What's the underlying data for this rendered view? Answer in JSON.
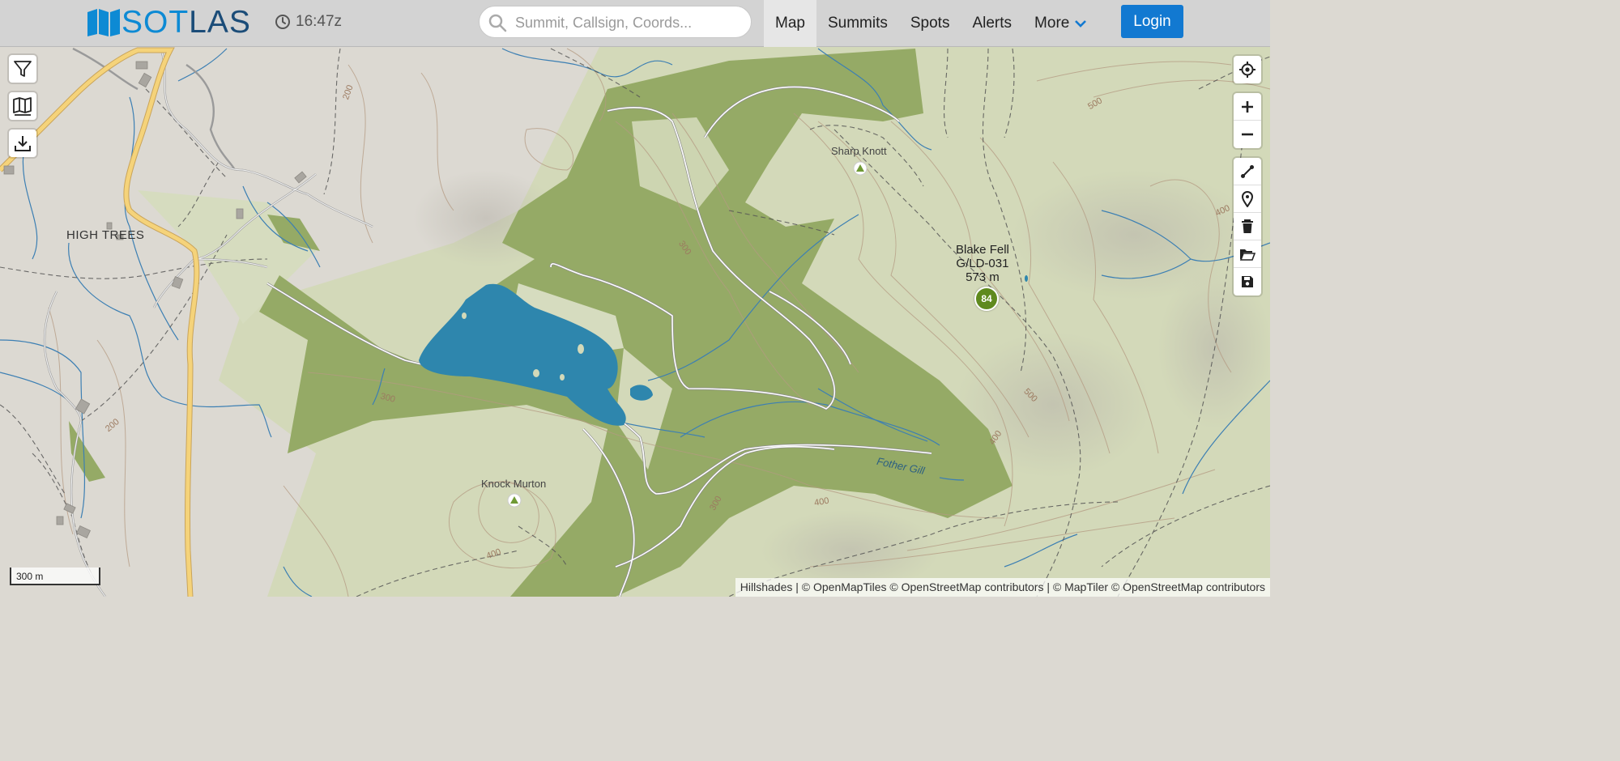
{
  "brand": {
    "part1": "SOT",
    "part2": "LAS"
  },
  "clock": {
    "time": "16:47z"
  },
  "search": {
    "placeholder": "Summit, Callsign, Coords..."
  },
  "nav": {
    "items": [
      {
        "label": "Map",
        "active": true
      },
      {
        "label": "Summits"
      },
      {
        "label": "Spots"
      },
      {
        "label": "Alerts"
      },
      {
        "label": "More"
      }
    ],
    "login_label": "Login"
  },
  "colors": {
    "accent": "#1279d1",
    "water": "#2e86ad",
    "forest": "#93a864",
    "summit_badge": "#5f8a1e"
  },
  "map": {
    "summits": [
      {
        "name": "Blake Fell",
        "ref": "G/LD-031",
        "elevation": "573 m",
        "points": "84"
      }
    ],
    "peaks": [
      {
        "name": "Sharp Knott"
      },
      {
        "name": "Knock Murton"
      }
    ],
    "places": [
      {
        "name": "HIGH TREES"
      }
    ],
    "waterways": [
      {
        "name": "Fother Gill"
      }
    ],
    "contour_labels": [
      "200",
      "300",
      "500",
      "300",
      "400",
      "500",
      "200",
      "300",
      "400",
      "400",
      "300",
      "400",
      "200"
    ],
    "scale": "300 m",
    "attribution": "Hillshades | © OpenMapTiles © OpenStreetMap contributors | © MapTiler © OpenStreetMap contributors"
  },
  "left_controls": [
    {
      "icon": "filter-icon"
    },
    {
      "icon": "map-layers-icon"
    },
    {
      "icon": "download-icon"
    }
  ],
  "right_controls": [
    {
      "icon": "locate-icon"
    },
    {
      "icon": "zoom-in-icon"
    },
    {
      "icon": "zoom-out-icon"
    },
    {
      "icon": "draw-line-icon"
    },
    {
      "icon": "draw-point-icon"
    },
    {
      "icon": "trash-icon"
    },
    {
      "icon": "open-folder-icon"
    },
    {
      "icon": "save-icon"
    }
  ]
}
